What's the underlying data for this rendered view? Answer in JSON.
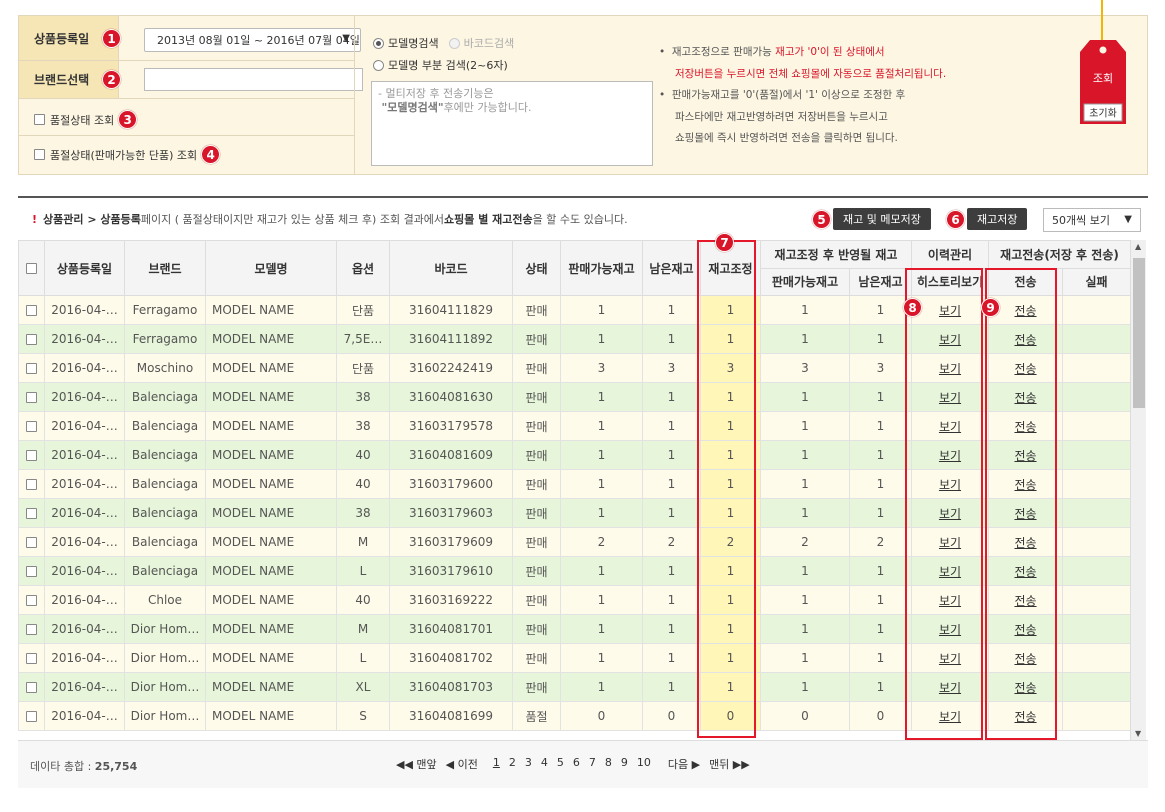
{
  "search": {
    "date_label": "상품등록일",
    "date_range": "2013년 08월 01일 ~ 2016년 07월 04일",
    "brand_label": "브랜드선택",
    "brand_value": "",
    "soldout_label": "품절상태 조회",
    "soldout_sellable_label": "품절상태(판매가능한 단품) 조회",
    "radio_model": "모델명검색",
    "radio_barcode": "바코드검색",
    "radio_partial": "모델명 부분 검색(2~6자)",
    "multi_placeholder_line1": "- 멀티저장 후 전송기능은",
    "multi_placeholder_line2_bold": "\"모델명검색\"",
    "multi_placeholder_line2_rest": "후에만 가능합니다.",
    "note1_a": "재고조정으로 판매가능 ",
    "note1_b": "재고가 '0'이 된 상태에서",
    "note2": "저장버튼을 누르시면 전체 쇼핑몰에 자동으로 품절처리됩니다.",
    "note3": "판매가능재고를 '0'(품절)에서 '1' 이상으로 조정한 후",
    "note4": "파스타에만 재고반영하려면 저장버튼을 누르시고",
    "note5": "쇼핑몰에 즉시 반영하려면 전송을 클릭하면 됩니다.",
    "search_button": "조회",
    "reset_button": "초기화"
  },
  "badges": [
    "1",
    "2",
    "3",
    "4",
    "5",
    "6",
    "7",
    "8",
    "9"
  ],
  "toolbar": {
    "breadcrumb_mark": "!",
    "breadcrumb_bold": "상품관리 > 상품등록",
    "breadcrumb_rest": " 페이지 ( 품절상태이지만 재고가 있는 상품 체크 후) 조회 결과에서 ",
    "breadcrumb_bold2": "쇼핑몰 별 재고전송",
    "breadcrumb_tail": "을 할 수도 있습니다.",
    "save_with_memo": "재고 및 메모저장",
    "save_stock": "재고저장",
    "per_page": "50개씩 보기"
  },
  "table": {
    "headers": {
      "reg_date": "상품등록일",
      "brand": "브랜드",
      "model": "모델명",
      "option": "옵션",
      "barcode": "바코드",
      "status": "상태",
      "sellable": "판매가능재고",
      "remain": "남은재고",
      "adjust": "재고조정",
      "after_group": "재고조정 후 반영될 재고",
      "after_sellable": "판매가능재고",
      "after_remain": "남은재고",
      "history_group": "이력관리",
      "history": "히스토리보기",
      "send_group": "재고전송(저장 후 전송)",
      "send": "전송",
      "fail": "실패"
    },
    "rows": [
      {
        "date": "2016-04-…",
        "brand": "Ferragamo",
        "model": "MODEL NAME",
        "option": "단품",
        "barcode": "31604111829",
        "status": "판매",
        "sellable": "1",
        "remain": "1",
        "adjust": "1",
        "a_sell": "1",
        "a_remain": "1",
        "history": "보기",
        "send": "전송",
        "fail": ""
      },
      {
        "date": "2016-04-…",
        "brand": "Ferragamo",
        "model": "MODEL NAME",
        "option": "7,5E…",
        "barcode": "31604111892",
        "status": "판매",
        "sellable": "1",
        "remain": "1",
        "adjust": "1",
        "a_sell": "1",
        "a_remain": "1",
        "history": "보기",
        "send": "전송",
        "fail": ""
      },
      {
        "date": "2016-04-…",
        "brand": "Moschino",
        "model": "MODEL NAME",
        "option": "단품",
        "barcode": "31602242419",
        "status": "판매",
        "sellable": "3",
        "remain": "3",
        "adjust": "3",
        "a_sell": "3",
        "a_remain": "3",
        "history": "보기",
        "send": "전송",
        "fail": ""
      },
      {
        "date": "2016-04-…",
        "brand": "Balenciaga",
        "model": "MODEL NAME",
        "option": "38",
        "barcode": "31604081630",
        "status": "판매",
        "sellable": "1",
        "remain": "1",
        "adjust": "1",
        "a_sell": "1",
        "a_remain": "1",
        "history": "보기",
        "send": "전송",
        "fail": ""
      },
      {
        "date": "2016-04-…",
        "brand": "Balenciaga",
        "model": "MODEL NAME",
        "option": "38",
        "barcode": "31603179578",
        "status": "판매",
        "sellable": "1",
        "remain": "1",
        "adjust": "1",
        "a_sell": "1",
        "a_remain": "1",
        "history": "보기",
        "send": "전송",
        "fail": ""
      },
      {
        "date": "2016-04-…",
        "brand": "Balenciaga",
        "model": "MODEL NAME",
        "option": "40",
        "barcode": "31604081609",
        "status": "판매",
        "sellable": "1",
        "remain": "1",
        "adjust": "1",
        "a_sell": "1",
        "a_remain": "1",
        "history": "보기",
        "send": "전송",
        "fail": ""
      },
      {
        "date": "2016-04-…",
        "brand": "Balenciaga",
        "model": "MODEL NAME",
        "option": "40",
        "barcode": "31603179600",
        "status": "판매",
        "sellable": "1",
        "remain": "1",
        "adjust": "1",
        "a_sell": "1",
        "a_remain": "1",
        "history": "보기",
        "send": "전송",
        "fail": ""
      },
      {
        "date": "2016-04-…",
        "brand": "Balenciaga",
        "model": "MODEL NAME",
        "option": "38",
        "barcode": "31603179603",
        "status": "판매",
        "sellable": "1",
        "remain": "1",
        "adjust": "1",
        "a_sell": "1",
        "a_remain": "1",
        "history": "보기",
        "send": "전송",
        "fail": ""
      },
      {
        "date": "2016-04-…",
        "brand": "Balenciaga",
        "model": "MODEL NAME",
        "option": "M",
        "barcode": "31603179609",
        "status": "판매",
        "sellable": "2",
        "remain": "2",
        "adjust": "2",
        "a_sell": "2",
        "a_remain": "2",
        "history": "보기",
        "send": "전송",
        "fail": ""
      },
      {
        "date": "2016-04-…",
        "brand": "Balenciaga",
        "model": "MODEL NAME",
        "option": "L",
        "barcode": "31603179610",
        "status": "판매",
        "sellable": "1",
        "remain": "1",
        "adjust": "1",
        "a_sell": "1",
        "a_remain": "1",
        "history": "보기",
        "send": "전송",
        "fail": ""
      },
      {
        "date": "2016-04-…",
        "brand": "Chloe",
        "model": "MODEL NAME",
        "option": "40",
        "barcode": "31603169222",
        "status": "판매",
        "sellable": "1",
        "remain": "1",
        "adjust": "1",
        "a_sell": "1",
        "a_remain": "1",
        "history": "보기",
        "send": "전송",
        "fail": ""
      },
      {
        "date": "2016-04-…",
        "brand": "Dior Hom…",
        "model": "MODEL NAME",
        "option": "M",
        "barcode": "31604081701",
        "status": "판매",
        "sellable": "1",
        "remain": "1",
        "adjust": "1",
        "a_sell": "1",
        "a_remain": "1",
        "history": "보기",
        "send": "전송",
        "fail": ""
      },
      {
        "date": "2016-04-…",
        "brand": "Dior Hom…",
        "model": "MODEL NAME",
        "option": "L",
        "barcode": "31604081702",
        "status": "판매",
        "sellable": "1",
        "remain": "1",
        "adjust": "1",
        "a_sell": "1",
        "a_remain": "1",
        "history": "보기",
        "send": "전송",
        "fail": ""
      },
      {
        "date": "2016-04-…",
        "brand": "Dior Hom…",
        "model": "MODEL NAME",
        "option": "XL",
        "barcode": "31604081703",
        "status": "판매",
        "sellable": "1",
        "remain": "1",
        "adjust": "1",
        "a_sell": "1",
        "a_remain": "1",
        "history": "보기",
        "send": "전송",
        "fail": ""
      },
      {
        "date": "2016-04-…",
        "brand": "Dior Hom…",
        "model": "MODEL NAME",
        "option": "S",
        "barcode": "31604081699",
        "status": "품절",
        "sellable": "0",
        "remain": "0",
        "adjust": "0",
        "a_sell": "0",
        "a_remain": "0",
        "history": "보기",
        "send": "전송",
        "fail": ""
      }
    ]
  },
  "footer": {
    "total_label": "데이타 총합 : ",
    "total_value": "25,754",
    "first": "◀◀ 맨앞",
    "prev": "◀ 이전",
    "pages": [
      "1",
      "2",
      "3",
      "4",
      "5",
      "6",
      "7",
      "8",
      "9",
      "10"
    ],
    "next": "다음 ▶",
    "last": "맨뒤 ▶▶"
  },
  "colors": {
    "accent_red": "#d9152a",
    "panel_bg": "#fdf6e3",
    "row_yellow": "#fffbea",
    "row_green": "#e7f6da"
  }
}
